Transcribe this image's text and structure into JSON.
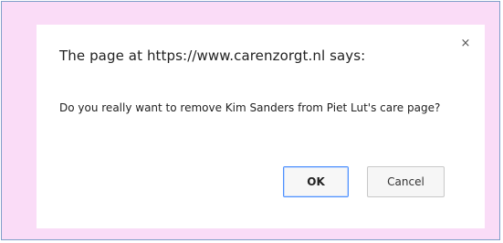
{
  "dialog": {
    "title": "The page at https://www.carenzorgt.nl says:",
    "message": "Do you really want to remove Kim Sanders from Piet Lut's care page?",
    "close_glyph": "×",
    "ok_label": "OK",
    "cancel_label": "Cancel"
  },
  "colors": {
    "backdrop": "#fadcf7",
    "frame_border": "#7f9fc9",
    "dialog_bg": "#ffffff",
    "ok_focus_border": "#4d90fe"
  },
  "icons": {
    "close": "close-icon"
  }
}
